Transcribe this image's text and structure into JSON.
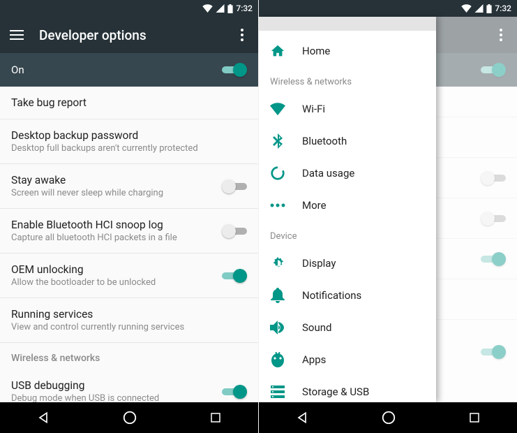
{
  "status": {
    "time": "7:32"
  },
  "left": {
    "title": "Developer options",
    "master": {
      "label": "On",
      "checked": true
    },
    "items": [
      {
        "primary": "Take bug report"
      },
      {
        "primary": "Desktop backup password",
        "secondary": "Desktop full backups aren't currently protected"
      },
      {
        "primary": "Stay awake",
        "secondary": "Screen will never sleep while charging",
        "switch": true,
        "checked": false
      },
      {
        "primary": "Enable Bluetooth HCI snoop log",
        "secondary": "Capture all bluetooth HCI packets in a file",
        "switch": true,
        "checked": false
      },
      {
        "primary": "OEM unlocking",
        "secondary": "Allow the bootloader to be unlocked",
        "switch": true,
        "checked": true
      },
      {
        "primary": "Running services",
        "secondary": "View and control currently running services"
      }
    ],
    "section": "Wireless & networks",
    "usb": {
      "primary": "USB debugging",
      "secondary": "Debug mode when USB is connected",
      "checked": true
    }
  },
  "drawer": {
    "home": "Home",
    "sec_wireless": "Wireless & networks",
    "wifi": "Wi-Fi",
    "bt": "Bluetooth",
    "data": "Data usage",
    "more": "More",
    "sec_device": "Device",
    "display": "Display",
    "notif": "Notifications",
    "sound": "Sound",
    "apps": "Apps",
    "storage": "Storage & USB"
  }
}
